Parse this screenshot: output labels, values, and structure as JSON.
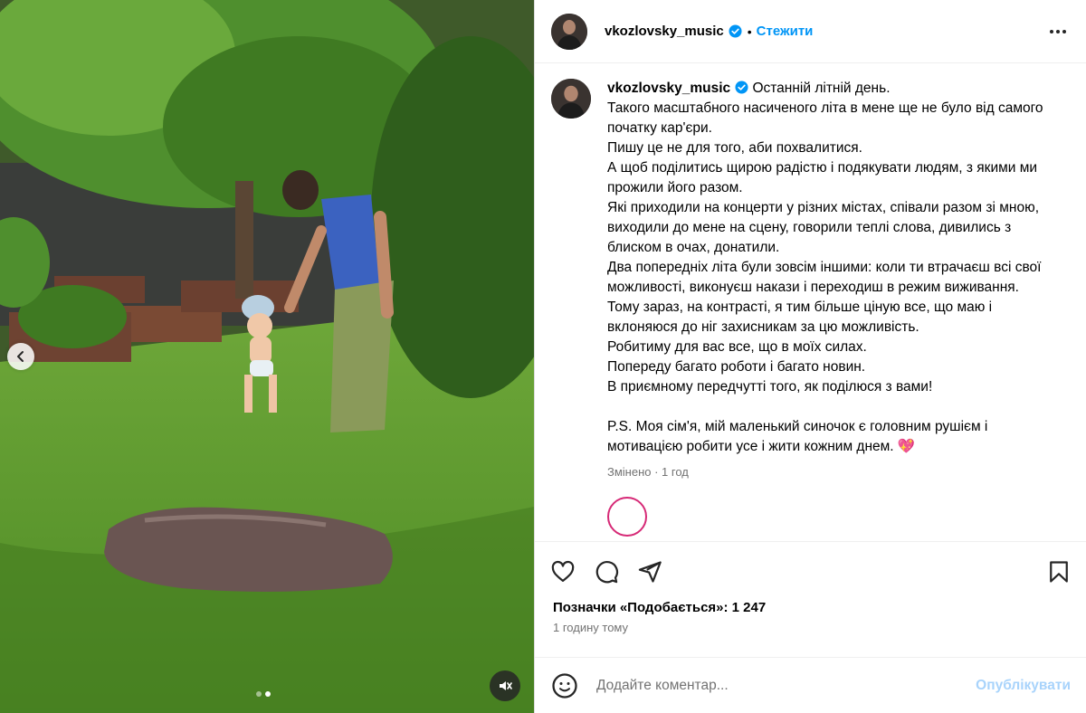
{
  "post": {
    "username": "vkozlovsky_music",
    "separator": "•",
    "follow_label": "Стежити",
    "caption_lines": [
      "Останній літній день.",
      "Такого масштабного насиченого літа в мене ще не було від самого початку кар'єри.",
      "Пишу це не для того, аби похвалитися.",
      "А щоб поділитись щирою радістю і подякувати людям, з якими ми прожили його разом.",
      "Які приходили на концерти у різних містах, співали разом зі мною, виходили до мене на сцену, говорили теплі слова, дивились з блиском в очах, донатили.",
      "Два попередніх літа були зовсім іншими: коли ти втрачаєш всі свої можливості, виконуєш накази і переходиш в режим виживання.",
      "Тому зараз, на контрасті, я тим більше ціную все, що маю і вклоняюся до ніг захисникам за цю можливість.",
      "Робитиму для вас все, що в моїх силах.",
      "Попереду багато роботи і багато новин.",
      "В приємному передчутті того, як поділюся з вами!",
      "",
      "P.S. Моя сім'я, мій маленький синочок є головним рушієм і мотивацією робити усе і жити кожним днем. 💖"
    ],
    "edited_meta": "Змінено · 1 год",
    "likes_text": "Позначки «Подобається»: 1 247",
    "time_ago": "1 годину тому",
    "comment_placeholder": "Додайте коментар...",
    "publish_label": "Опублікувати"
  },
  "icons": {
    "verified": "verified-badge-icon",
    "more": "more-options-icon",
    "like": "heart-icon",
    "comment": "comment-bubble-icon",
    "share": "paper-plane-icon",
    "save": "bookmark-icon",
    "emoji": "emoji-smile-icon",
    "prev": "chevron-left-icon",
    "mute": "sound-off-icon"
  },
  "colors": {
    "link": "#0095f6",
    "publish_disabled": "#a8d3fb",
    "verified": "#0095f6",
    "muted_text": "#737373"
  },
  "carousel": {
    "slides": 2,
    "active_index": 2
  }
}
